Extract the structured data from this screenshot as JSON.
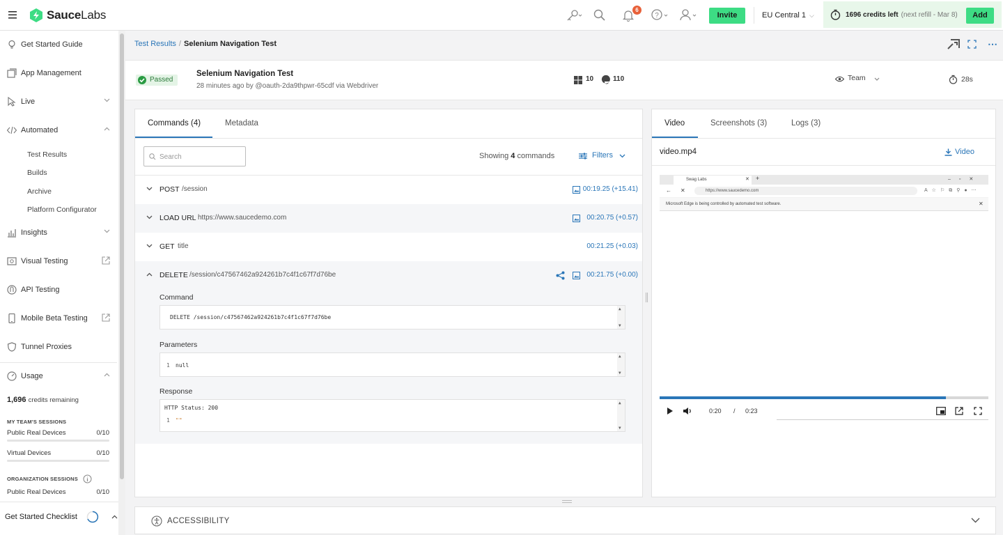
{
  "header": {
    "logo_text_a": "Sauce",
    "logo_text_b": "Labs",
    "notification_count": "6",
    "invite_label": "Invite",
    "region": "EU Central 1",
    "credits_text": "1696 credits left",
    "refill_text": "(next refill - Mar 8)",
    "add_label": "Add",
    "accent": "#3ddc84"
  },
  "sidebar": {
    "items": [
      {
        "label": "Get Started Guide",
        "icon": "lightbulb-icon"
      },
      {
        "label": "App Management",
        "icon": "app-management-icon"
      },
      {
        "label": "Live",
        "icon": "pointer-icon"
      },
      {
        "label": "Automated",
        "icon": "code-icon"
      },
      {
        "label": "Insights",
        "icon": "bar-chart-icon"
      },
      {
        "label": "Visual Testing",
        "icon": "visual-testing-icon"
      },
      {
        "label": "API Testing",
        "icon": "api-icon"
      },
      {
        "label": "Mobile Beta Testing",
        "icon": "mobile-icon"
      },
      {
        "label": "Tunnel Proxies",
        "icon": "shield-icon"
      }
    ],
    "automated_sub": [
      "Test Results",
      "Builds",
      "Archive",
      "Platform Configurator"
    ],
    "usage": {
      "label": "Usage",
      "credits_value": "1,696",
      "credits_label": "credits remaining",
      "team_heading": "MY TEAM'S SESSIONS",
      "team_rows": [
        {
          "label": "Public Real Devices",
          "value": "0/10"
        },
        {
          "label": "Virtual Devices",
          "value": "0/10"
        }
      ],
      "org_heading": "ORGANIZATION SESSIONS",
      "org_rows": [
        {
          "label": "Public Real Devices",
          "value": "0/10"
        }
      ]
    },
    "checklist_label": "Get Started Checklist"
  },
  "breadcrumb": {
    "parent": "Test Results",
    "separator": "/",
    "current": "Selenium Navigation Test"
  },
  "summary": {
    "status": "Passed",
    "title": "Selenium Navigation Test",
    "subtitle": "28 minutes ago by @oauth-2da9thpwr-65cdf via Webdriver",
    "os_version": "10",
    "browser_version": "110",
    "visibility": "Team",
    "duration": "28s"
  },
  "commands_panel": {
    "tabs": [
      "Commands (4)",
      "Metadata"
    ],
    "search_placeholder": "Search",
    "showing_prefix": "Showing",
    "showing_count": "4",
    "showing_suffix": "commands",
    "filters_label": "Filters",
    "rows": [
      {
        "verb": "POST",
        "arg": "/session",
        "time": "00:19.25 (+15.41)"
      },
      {
        "verb": "LOAD URL",
        "arg": "https://www.saucedemo.com",
        "time": "00:20.75 (+0.57)"
      },
      {
        "verb": "GET",
        "arg": "title",
        "time": "00:21.25 (+0.03)"
      },
      {
        "verb": "DELETE",
        "arg": "/session/c47567462a924261b7c4f1c67f7d76be",
        "time": "00:21.75 (+0.00)"
      }
    ],
    "detail": {
      "command_label": "Command",
      "command_text": "DELETE /session/c47567462a924261b7c4f1c67f7d76be",
      "parameters_label": "Parameters",
      "param_line_no": "1",
      "param_value": "null",
      "response_label": "Response",
      "response_status": "HTTP Status: 200",
      "response_line_no": "1",
      "response_value": "\"\""
    }
  },
  "video_panel": {
    "tabs": [
      "Video",
      "Screenshots (3)",
      "Logs (3)"
    ],
    "file_name": "video.mp4",
    "download_label": "Video",
    "browser_tab_title": "Swag Labs",
    "browser_url": "https://www.saucedemo.com",
    "browser_notice": "Microsoft Edge is being controlled by automated test software.",
    "current_time": "0:20",
    "time_sep": "/",
    "total_time": "0:23",
    "progress_fraction": 0.87
  },
  "accessibility_label": "ACCESSIBILITY"
}
